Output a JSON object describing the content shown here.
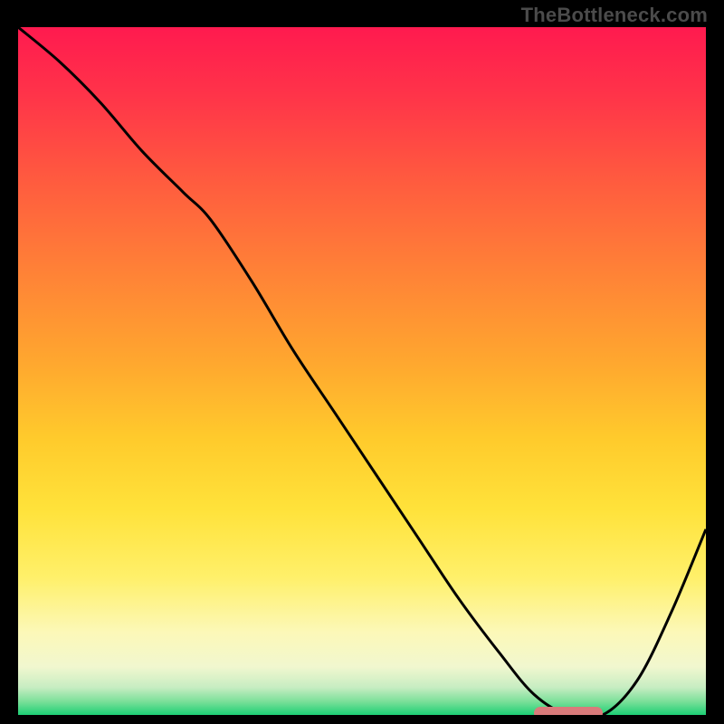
{
  "attribution": "TheBottleneck.com",
  "chart_data": {
    "type": "line",
    "title": "",
    "xlabel": "",
    "ylabel": "",
    "xlim": [
      0,
      100
    ],
    "ylim": [
      0,
      100
    ],
    "grid": false,
    "legend": false,
    "series": [
      {
        "name": "curve",
        "x": [
          0,
          6,
          12,
          18,
          24,
          28,
          34,
          40,
          46,
          52,
          58,
          64,
          70,
          75,
          80,
          85,
          90,
          95,
          100
        ],
        "y": [
          100,
          95,
          89,
          82,
          76,
          72,
          63,
          53,
          44,
          35,
          26,
          17,
          9,
          3,
          0,
          0,
          5,
          15,
          27
        ]
      }
    ],
    "marker": {
      "x_start": 75,
      "x_end": 85,
      "y": 0,
      "color": "#d97b7b"
    },
    "gradient_stops": [
      {
        "pct": 0,
        "color": "#ff1a4f"
      },
      {
        "pct": 10,
        "color": "#ff3449"
      },
      {
        "pct": 22,
        "color": "#ff5a3f"
      },
      {
        "pct": 35,
        "color": "#ff8037"
      },
      {
        "pct": 48,
        "color": "#ffa52f"
      },
      {
        "pct": 60,
        "color": "#ffcb2c"
      },
      {
        "pct": 70,
        "color": "#ffe23a"
      },
      {
        "pct": 80,
        "color": "#fff06a"
      },
      {
        "pct": 88,
        "color": "#fcf8b8"
      },
      {
        "pct": 93,
        "color": "#f1f7cf"
      },
      {
        "pct": 96,
        "color": "#c7edc2"
      },
      {
        "pct": 98,
        "color": "#7de09a"
      },
      {
        "pct": 100,
        "color": "#1ccf74"
      }
    ]
  }
}
